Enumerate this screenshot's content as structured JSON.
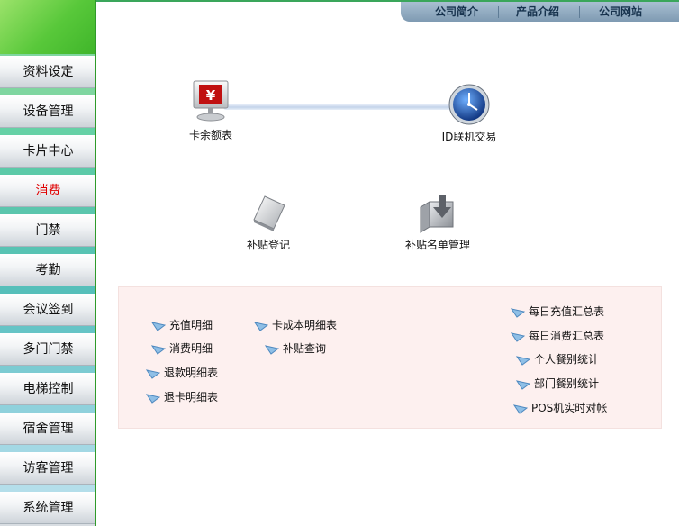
{
  "sidebar": {
    "items": [
      {
        "label": "资料设定",
        "active": false
      },
      {
        "label": "设备管理",
        "active": false
      },
      {
        "label": "卡片中心",
        "active": false
      },
      {
        "label": "消费",
        "active": true
      },
      {
        "label": "门禁",
        "active": false
      },
      {
        "label": "考勤",
        "active": false
      },
      {
        "label": "会议签到",
        "active": false
      },
      {
        "label": "多门门禁",
        "active": false
      },
      {
        "label": "电梯控制",
        "active": false
      },
      {
        "label": "宿舍管理",
        "active": false
      },
      {
        "label": "访客管理",
        "active": false
      },
      {
        "label": "系统管理",
        "active": false
      }
    ],
    "active_color": "#e00000"
  },
  "topnav": {
    "tabs": [
      "公司简介",
      "产品介绍",
      "公司网站"
    ]
  },
  "flow": {
    "card_balance": "卡余额表",
    "id_online": "ID联机交易",
    "subsidy_register": "补贴登记",
    "subsidy_list": "补贴名单管理"
  },
  "reports": {
    "left": [
      "充值明细",
      "消费明细",
      "退款明细表",
      "退卡明细表"
    ],
    "middle": [
      "卡成本明细表",
      "补贴查询"
    ],
    "right": [
      "每日充值汇总表",
      "每日消费汇总表",
      "个人餐别统计",
      "部门餐别统计",
      "POS机实时对帐"
    ]
  }
}
